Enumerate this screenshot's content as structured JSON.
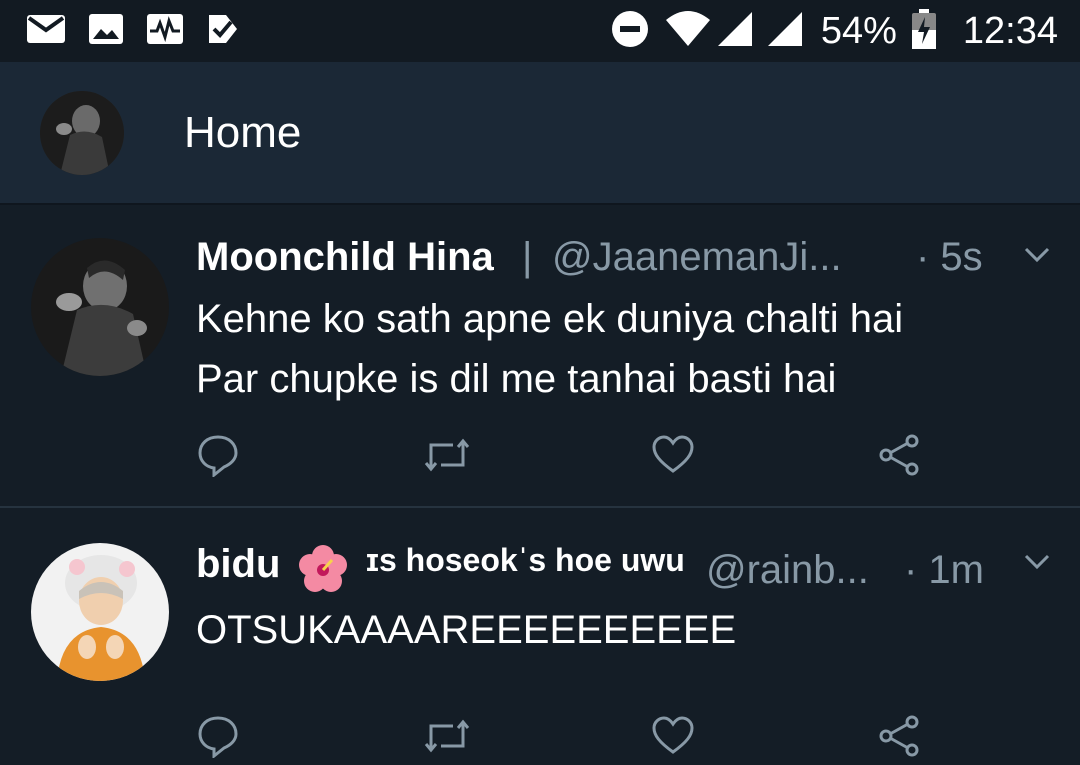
{
  "status_bar": {
    "battery": "54%",
    "time": "12:34",
    "left_icons": [
      "mail-icon",
      "image-icon",
      "activity-icon",
      "checkbox-icon"
    ],
    "right_icons": [
      "do-not-disturb-icon",
      "wifi-icon",
      "signal-icon",
      "signal-icon",
      "battery-charging-icon"
    ]
  },
  "header": {
    "title": "Home"
  },
  "tweets": [
    {
      "name": "Moonchild Hina",
      "separator": "|",
      "handle": "@JaanemanJi...",
      "time": "· 5s",
      "lines": [
        "Kehne ko sath apne ek duniya chalti hai",
        "Par chupke is dil me tanhai basti hai"
      ]
    },
    {
      "name": "bidu",
      "name_suffix": "ɪs hoseokˈs hoe uwu",
      "handle": "@rainb...",
      "time": "· 1m",
      "lines": [
        "OTSUKAAAAREEEEEEEEEE"
      ]
    }
  ],
  "colors": {
    "background": "#141d26",
    "header": "#1b2836",
    "secondary_text": "#8899a6"
  }
}
